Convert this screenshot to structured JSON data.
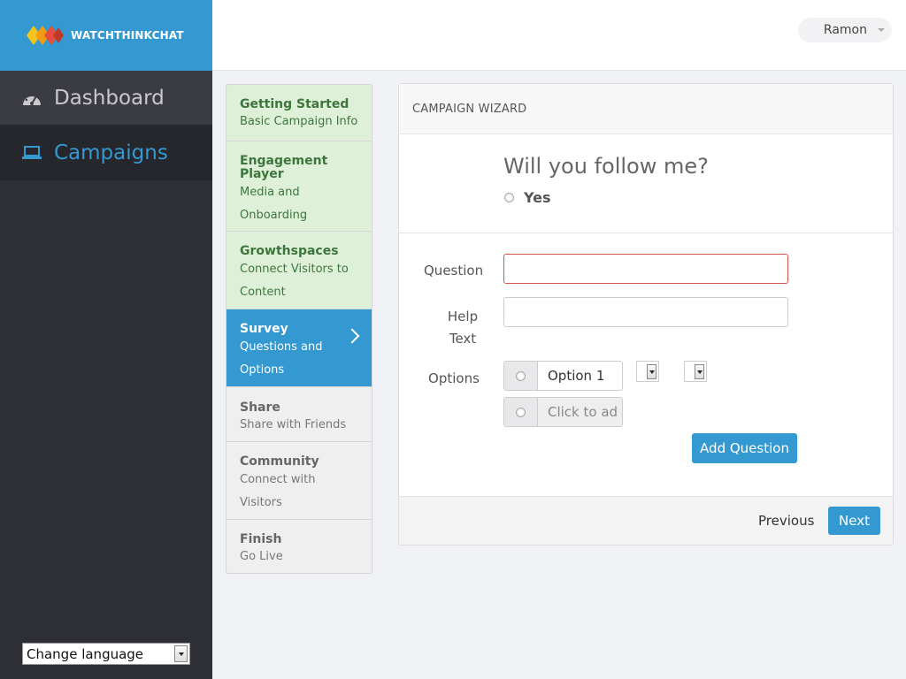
{
  "brand": {
    "name": "WATCHTHINKCHAT"
  },
  "sidebar": {
    "items": [
      {
        "label": "Dashboard",
        "icon": "dashboard-gauge-icon"
      },
      {
        "label": "Campaigns",
        "icon": "laptop-icon"
      }
    ],
    "language_select": {
      "value": "Change language"
    }
  },
  "header": {
    "user": "Ramon"
  },
  "steps": [
    {
      "title": "Getting Started",
      "subtitle": "Basic Campaign Info",
      "state": "done"
    },
    {
      "title": "Engagement Player",
      "subtitle": "Media and Onboarding",
      "state": "done"
    },
    {
      "title": "Growthspaces",
      "subtitle": "Connect Visitors to Content",
      "state": "done"
    },
    {
      "title": "Survey",
      "subtitle": "Questions and Options",
      "state": "active"
    },
    {
      "title": "Share",
      "subtitle": "Share with Friends",
      "state": "pending"
    },
    {
      "title": "Community",
      "subtitle": "Connect with Visitors",
      "state": "pending"
    },
    {
      "title": "Finish",
      "subtitle": "Go Live",
      "state": "pending"
    }
  ],
  "wizard": {
    "title": "CAMPAIGN WIZARD",
    "preview": {
      "question": "Will you follow me?",
      "option": "Yes"
    },
    "form": {
      "question_label": "Question",
      "question_value": "",
      "help_label": "Help Text",
      "help_value": "",
      "options_label": "Options",
      "options": [
        {
          "value": "Option 1"
        },
        {
          "placeholder": "Click to ad"
        }
      ]
    },
    "add_question": "Add Question",
    "previous": "Previous",
    "next": "Next"
  },
  "colors": {
    "accent": "#3498d1",
    "sidebar": "#2e2f36",
    "done": "#dff0d8",
    "done_text": "#3c763d",
    "error": "#d9534f"
  }
}
